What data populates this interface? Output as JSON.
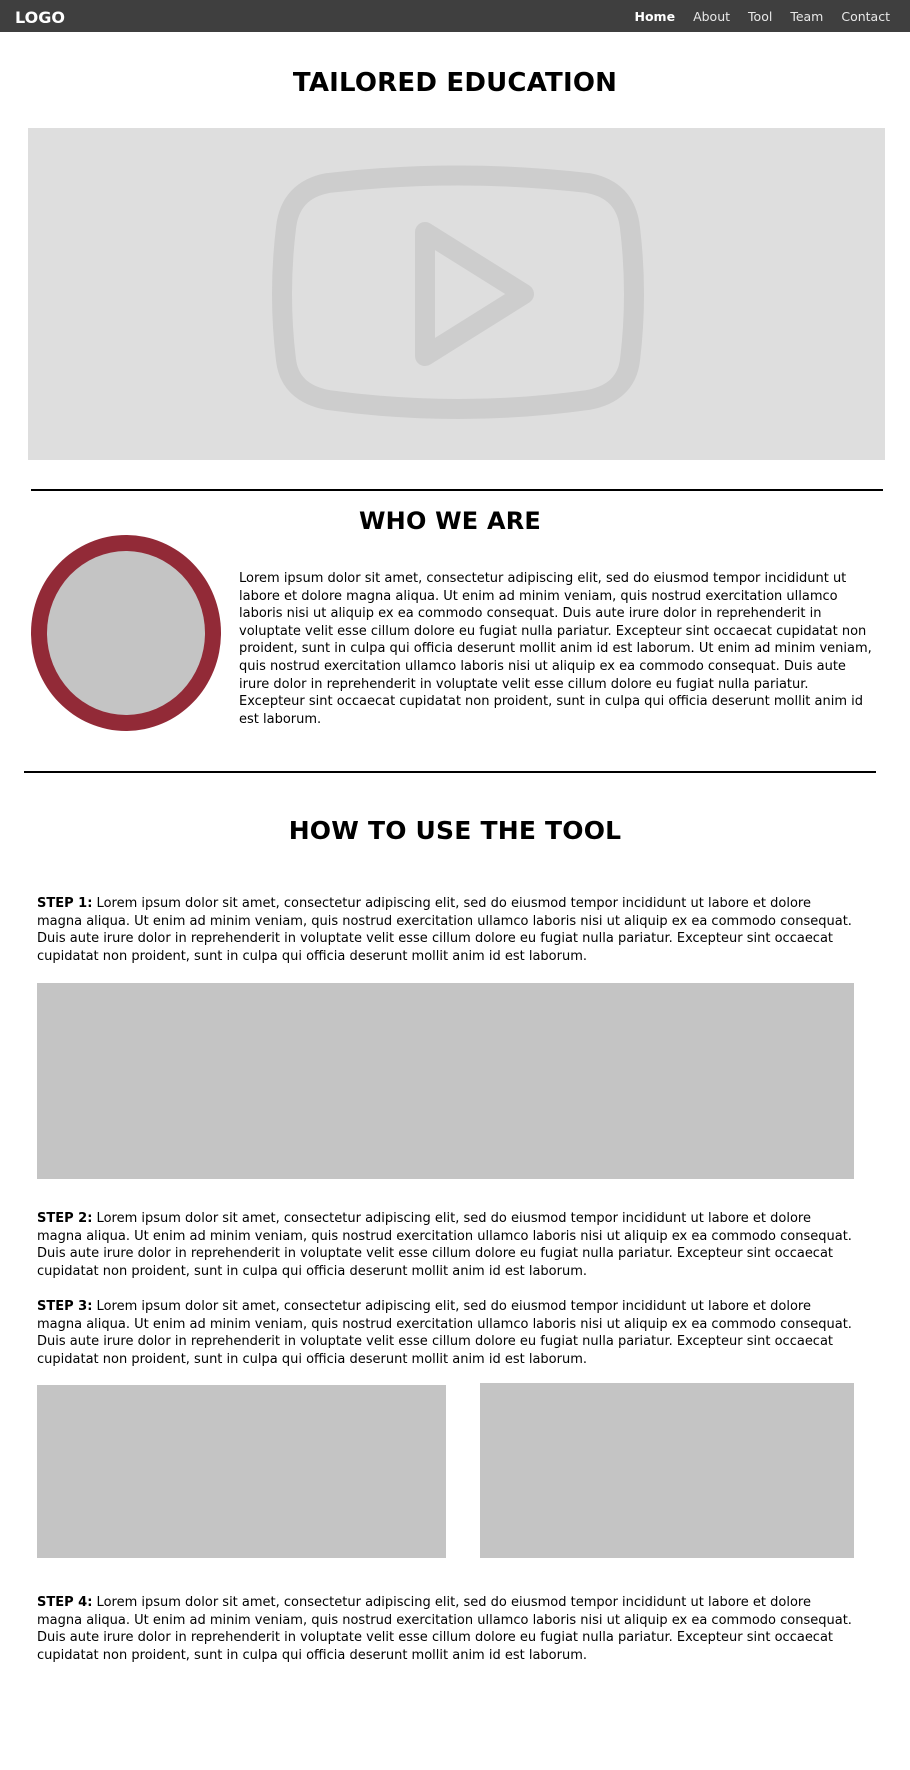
{
  "nav": {
    "logo": "LOGO",
    "links": [
      "Home",
      "About",
      "Tool",
      "Team",
      "Contact"
    ],
    "active": "Home"
  },
  "hero": {
    "title": "TAILORED EDUCATION",
    "video_icon": "play-video-icon"
  },
  "who": {
    "title": "WHO WE ARE",
    "text": "Lorem ipsum dolor sit amet, consectetur adipiscing elit, sed do eiusmod tempor incididunt ut labore et dolore magna aliqua. Ut enim ad minim veniam, quis nostrud exercitation ullamco laboris nisi ut aliquip ex ea commodo consequat. Duis aute irure dolor in reprehenderit in voluptate velit esse cillum dolore eu fugiat nulla pariatur. Excepteur sint occaecat cupidatat non proident, sunt in culpa qui officia deserunt mollit anim id est laborum. Ut enim ad minim veniam, quis nostrud exercitation ullamco laboris nisi ut aliquip ex ea commodo consequat. Duis aute irure dolor in reprehenderit in voluptate velit esse cillum dolore eu fugiat nulla pariatur. Excepteur sint occaecat cupidatat non proident, sunt in culpa qui officia deserunt mollit anim id est laborum."
  },
  "how": {
    "title": "HOW TO USE THE TOOL",
    "steps": [
      {
        "label": "STEP 1:",
        "text": " Lorem ipsum dolor sit amet, consectetur adipiscing elit, sed do eiusmod tempor incididunt ut labore et dolore magna aliqua. Ut enim ad minim veniam, quis nostrud exercitation ullamco laboris nisi ut aliquip ex ea commodo consequat. Duis aute irure dolor in reprehenderit in voluptate velit esse cillum dolore eu fugiat nulla pariatur. Excepteur sint occaecat cupidatat non proident, sunt in culpa qui officia deserunt mollit anim id est laborum."
      },
      {
        "label": "STEP 2:",
        "text": " Lorem ipsum dolor sit amet, consectetur adipiscing elit, sed do eiusmod tempor incididunt ut labore et dolore magna aliqua. Ut enim ad minim veniam, quis nostrud exercitation ullamco laboris nisi ut aliquip ex ea commodo consequat. Duis aute irure dolor in reprehenderit in voluptate velit esse cillum dolore eu fugiat nulla pariatur. Excepteur sint occaecat cupidatat non proident, sunt in culpa qui officia deserunt mollit anim id est laborum."
      },
      {
        "label": "STEP 3:",
        "text": " Lorem ipsum dolor sit amet, consectetur adipiscing elit, sed do eiusmod tempor incididunt ut labore et dolore magna aliqua. Ut enim ad minim veniam, quis nostrud exercitation ullamco laboris nisi ut aliquip ex ea commodo consequat. Duis aute irure dolor in reprehenderit in voluptate velit esse cillum dolore eu fugiat nulla pariatur. Excepteur sint occaecat cupidatat non proident, sunt in culpa qui officia deserunt mollit anim id est laborum."
      },
      {
        "label": "STEP 4:",
        "text": " Lorem ipsum dolor sit amet, consectetur adipiscing elit, sed do eiusmod tempor incididunt ut labore et dolore magna aliqua. Ut enim ad minim veniam, quis nostrud exercitation ullamco laboris nisi ut aliquip ex ea commodo consequat. Duis aute irure dolor in reprehenderit in voluptate velit esse cillum dolore eu fugiat nulla pariatur. Excepteur sint occaecat cupidatat non proident, sunt in culpa qui officia deserunt mollit anim id est laborum."
      }
    ]
  },
  "colors": {
    "navbar": "#3f3f3f",
    "avatar_ring": "#922a37",
    "placeholder": "#c4c4c4",
    "video_bg": "#dedede"
  }
}
